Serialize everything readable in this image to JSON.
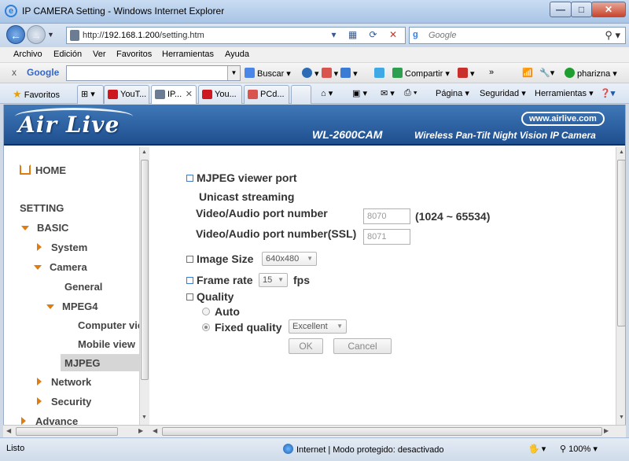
{
  "window": {
    "title": "IP CAMERA Setting - Windows Internet Explorer",
    "min": "—",
    "max": "□",
    "close": "✕"
  },
  "address": {
    "url_prefix": "http://",
    "url_host": "192.168.1.200",
    "url_path": "/setting.htm",
    "search_placeholder": "Google"
  },
  "menu": [
    "Archivo",
    "Edición",
    "Ver",
    "Favoritos",
    "Herramientas",
    "Ayuda"
  ],
  "google_toolbar": {
    "label": "Google",
    "buscar": "Buscar",
    "compartir": "Compartir",
    "more": "»",
    "user": "pharizna"
  },
  "favbar": {
    "favoritos": "Favoritos",
    "tabs": [
      "YouT...",
      "IP...",
      "You...",
      "PCd..."
    ],
    "pagina": "Página",
    "seguridad": "Seguridad",
    "herramientas": "Herramientas"
  },
  "banner": {
    "logo": "Air Live",
    "url": "www.airlive.com",
    "model": "WL-2600CAM",
    "subtitle": "Wireless Pan-Tilt Night Vision IP Camera"
  },
  "nav": {
    "home": "HOME",
    "setting": "SETTING",
    "basic": "BASIC",
    "system": "System",
    "camera": "Camera",
    "general": "General",
    "mpeg4": "MPEG4",
    "computer": "Computer view",
    "mobile": "Mobile view",
    "mjpeg": "MJPEG",
    "network": "Network",
    "security": "Security",
    "advance": "Advance"
  },
  "content": {
    "viewer_port": "MJPEG viewer port",
    "unicast": "Unicast streaming",
    "port_label": "Video/Audio port number",
    "port_value": "8070",
    "port_range": "(1024 ~ 65534)",
    "ssl_label": "Video/Audio port number(SSL)",
    "ssl_value": "8071",
    "image_size_label": "Image Size",
    "image_size_value": "640x480",
    "frame_rate_label": "Frame rate",
    "frame_rate_value": "15",
    "fps": "fps",
    "quality_label": "Quality",
    "auto": "Auto",
    "fixed": "Fixed quality",
    "fixed_value": "Excellent",
    "ok": "OK",
    "cancel": "Cancel"
  },
  "status": {
    "left": "Listo",
    "zone": "Internet | Modo protegido: desactivado",
    "zoom": "100%"
  },
  "colors": {
    "banner": "#1f4f8f",
    "nav_arrow": "#e07b10",
    "checkbox": "#3a7bd5"
  }
}
